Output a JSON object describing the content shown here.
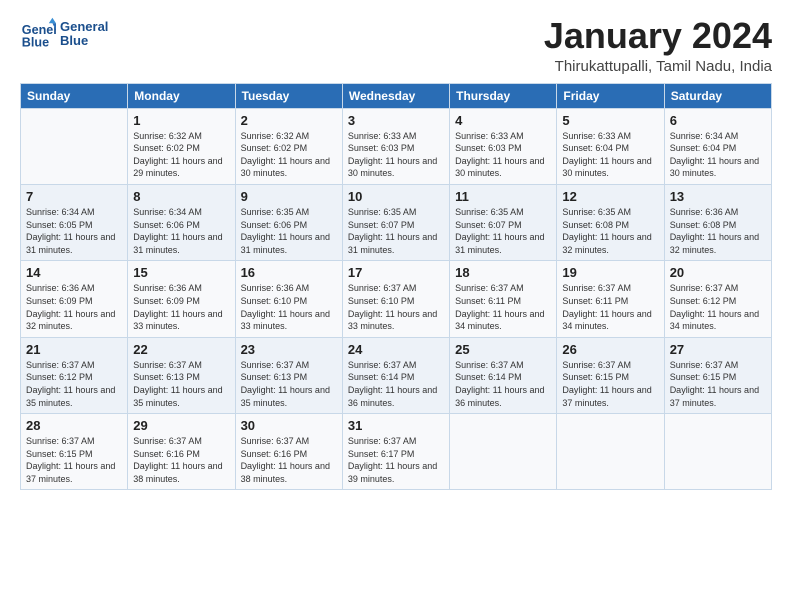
{
  "logo": {
    "line1": "General",
    "line2": "Blue"
  },
  "title": "January 2024",
  "subtitle": "Thirukattupalli, Tamil Nadu, India",
  "days_header": [
    "Sunday",
    "Monday",
    "Tuesday",
    "Wednesday",
    "Thursday",
    "Friday",
    "Saturday"
  ],
  "weeks": [
    [
      {
        "num": "",
        "sunrise": "",
        "sunset": "",
        "daylight": ""
      },
      {
        "num": "1",
        "sunrise": "Sunrise: 6:32 AM",
        "sunset": "Sunset: 6:02 PM",
        "daylight": "Daylight: 11 hours and 29 minutes."
      },
      {
        "num": "2",
        "sunrise": "Sunrise: 6:32 AM",
        "sunset": "Sunset: 6:02 PM",
        "daylight": "Daylight: 11 hours and 30 minutes."
      },
      {
        "num": "3",
        "sunrise": "Sunrise: 6:33 AM",
        "sunset": "Sunset: 6:03 PM",
        "daylight": "Daylight: 11 hours and 30 minutes."
      },
      {
        "num": "4",
        "sunrise": "Sunrise: 6:33 AM",
        "sunset": "Sunset: 6:03 PM",
        "daylight": "Daylight: 11 hours and 30 minutes."
      },
      {
        "num": "5",
        "sunrise": "Sunrise: 6:33 AM",
        "sunset": "Sunset: 6:04 PM",
        "daylight": "Daylight: 11 hours and 30 minutes."
      },
      {
        "num": "6",
        "sunrise": "Sunrise: 6:34 AM",
        "sunset": "Sunset: 6:04 PM",
        "daylight": "Daylight: 11 hours and 30 minutes."
      }
    ],
    [
      {
        "num": "7",
        "sunrise": "Sunrise: 6:34 AM",
        "sunset": "Sunset: 6:05 PM",
        "daylight": "Daylight: 11 hours and 31 minutes."
      },
      {
        "num": "8",
        "sunrise": "Sunrise: 6:34 AM",
        "sunset": "Sunset: 6:06 PM",
        "daylight": "Daylight: 11 hours and 31 minutes."
      },
      {
        "num": "9",
        "sunrise": "Sunrise: 6:35 AM",
        "sunset": "Sunset: 6:06 PM",
        "daylight": "Daylight: 11 hours and 31 minutes."
      },
      {
        "num": "10",
        "sunrise": "Sunrise: 6:35 AM",
        "sunset": "Sunset: 6:07 PM",
        "daylight": "Daylight: 11 hours and 31 minutes."
      },
      {
        "num": "11",
        "sunrise": "Sunrise: 6:35 AM",
        "sunset": "Sunset: 6:07 PM",
        "daylight": "Daylight: 11 hours and 31 minutes."
      },
      {
        "num": "12",
        "sunrise": "Sunrise: 6:35 AM",
        "sunset": "Sunset: 6:08 PM",
        "daylight": "Daylight: 11 hours and 32 minutes."
      },
      {
        "num": "13",
        "sunrise": "Sunrise: 6:36 AM",
        "sunset": "Sunset: 6:08 PM",
        "daylight": "Daylight: 11 hours and 32 minutes."
      }
    ],
    [
      {
        "num": "14",
        "sunrise": "Sunrise: 6:36 AM",
        "sunset": "Sunset: 6:09 PM",
        "daylight": "Daylight: 11 hours and 32 minutes."
      },
      {
        "num": "15",
        "sunrise": "Sunrise: 6:36 AM",
        "sunset": "Sunset: 6:09 PM",
        "daylight": "Daylight: 11 hours and 33 minutes."
      },
      {
        "num": "16",
        "sunrise": "Sunrise: 6:36 AM",
        "sunset": "Sunset: 6:10 PM",
        "daylight": "Daylight: 11 hours and 33 minutes."
      },
      {
        "num": "17",
        "sunrise": "Sunrise: 6:37 AM",
        "sunset": "Sunset: 6:10 PM",
        "daylight": "Daylight: 11 hours and 33 minutes."
      },
      {
        "num": "18",
        "sunrise": "Sunrise: 6:37 AM",
        "sunset": "Sunset: 6:11 PM",
        "daylight": "Daylight: 11 hours and 34 minutes."
      },
      {
        "num": "19",
        "sunrise": "Sunrise: 6:37 AM",
        "sunset": "Sunset: 6:11 PM",
        "daylight": "Daylight: 11 hours and 34 minutes."
      },
      {
        "num": "20",
        "sunrise": "Sunrise: 6:37 AM",
        "sunset": "Sunset: 6:12 PM",
        "daylight": "Daylight: 11 hours and 34 minutes."
      }
    ],
    [
      {
        "num": "21",
        "sunrise": "Sunrise: 6:37 AM",
        "sunset": "Sunset: 6:12 PM",
        "daylight": "Daylight: 11 hours and 35 minutes."
      },
      {
        "num": "22",
        "sunrise": "Sunrise: 6:37 AM",
        "sunset": "Sunset: 6:13 PM",
        "daylight": "Daylight: 11 hours and 35 minutes."
      },
      {
        "num": "23",
        "sunrise": "Sunrise: 6:37 AM",
        "sunset": "Sunset: 6:13 PM",
        "daylight": "Daylight: 11 hours and 35 minutes."
      },
      {
        "num": "24",
        "sunrise": "Sunrise: 6:37 AM",
        "sunset": "Sunset: 6:14 PM",
        "daylight": "Daylight: 11 hours and 36 minutes."
      },
      {
        "num": "25",
        "sunrise": "Sunrise: 6:37 AM",
        "sunset": "Sunset: 6:14 PM",
        "daylight": "Daylight: 11 hours and 36 minutes."
      },
      {
        "num": "26",
        "sunrise": "Sunrise: 6:37 AM",
        "sunset": "Sunset: 6:15 PM",
        "daylight": "Daylight: 11 hours and 37 minutes."
      },
      {
        "num": "27",
        "sunrise": "Sunrise: 6:37 AM",
        "sunset": "Sunset: 6:15 PM",
        "daylight": "Daylight: 11 hours and 37 minutes."
      }
    ],
    [
      {
        "num": "28",
        "sunrise": "Sunrise: 6:37 AM",
        "sunset": "Sunset: 6:15 PM",
        "daylight": "Daylight: 11 hours and 37 minutes."
      },
      {
        "num": "29",
        "sunrise": "Sunrise: 6:37 AM",
        "sunset": "Sunset: 6:16 PM",
        "daylight": "Daylight: 11 hours and 38 minutes."
      },
      {
        "num": "30",
        "sunrise": "Sunrise: 6:37 AM",
        "sunset": "Sunset: 6:16 PM",
        "daylight": "Daylight: 11 hours and 38 minutes."
      },
      {
        "num": "31",
        "sunrise": "Sunrise: 6:37 AM",
        "sunset": "Sunset: 6:17 PM",
        "daylight": "Daylight: 11 hours and 39 minutes."
      },
      {
        "num": "",
        "sunrise": "",
        "sunset": "",
        "daylight": ""
      },
      {
        "num": "",
        "sunrise": "",
        "sunset": "",
        "daylight": ""
      },
      {
        "num": "",
        "sunrise": "",
        "sunset": "",
        "daylight": ""
      }
    ]
  ]
}
